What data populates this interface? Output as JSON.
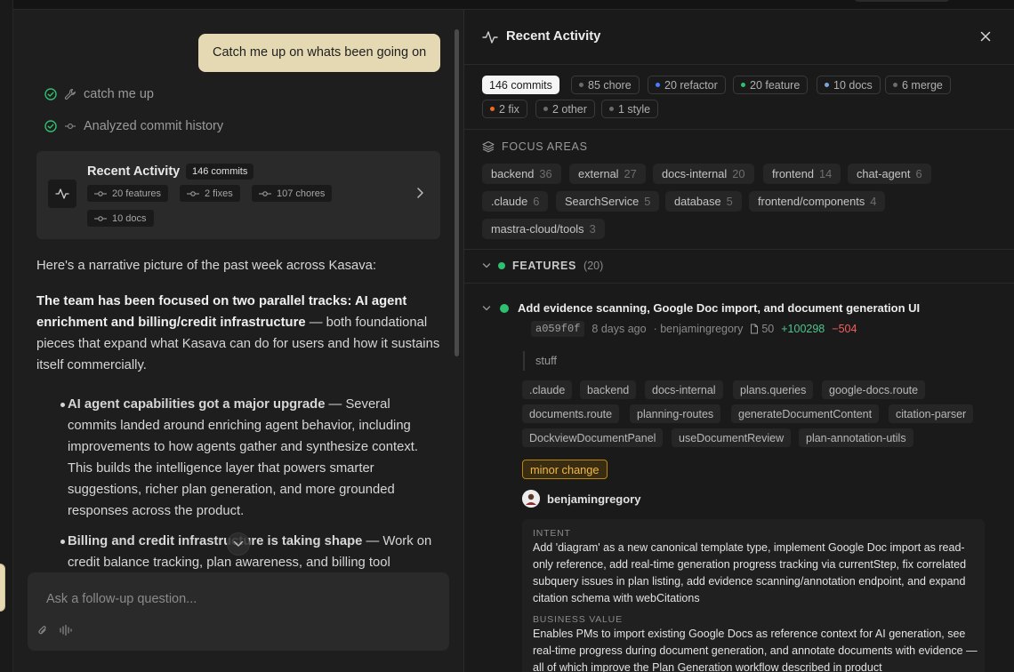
{
  "chat": {
    "user_message": "Catch me up on whats been going on",
    "steps": [
      {
        "label": "catch me up",
        "status": "done"
      },
      {
        "label": "Analyzed commit history",
        "status": "done"
      }
    ],
    "activity_card": {
      "title": "Recent Activity",
      "count": "146 commits",
      "stats": [
        "20 features",
        "2 fixes",
        "107 chores",
        "10 docs"
      ]
    },
    "intro": "Here's a narrative picture of the past week across Kasava:",
    "p2_bold": "The team has been focused on two parallel tracks: AI agent enrichment and billing/credit infrastructure",
    "p2_rest": " — both foundational pieces that expand what Kasava can do for users and how it sustains itself commercially.",
    "bullets": [
      {
        "bold": "AI agent capabilities got a major upgrade",
        "rest": " — Several commits landed around enriching agent behavior, including improvements to how agents gather and synthesize context. This builds the intelligence layer that powers smarter suggestions, richer plan generation, and more grounded responses across the product."
      },
      {
        "bold": "Billing and credit infrastructure is taking shape",
        "rest": " — Work on credit balance tracking, plan awareness, and billing tool"
      }
    ],
    "composer_placeholder": "Ask a follow-up question..."
  },
  "panel": {
    "title": "Recent Activity",
    "filters": [
      {
        "label": "146 commits",
        "active": true,
        "color": ""
      },
      {
        "label": "85 chore",
        "active": false,
        "color": "#6b6b6b"
      },
      {
        "label": "20 refactor",
        "active": false,
        "color": "#4a7cff"
      },
      {
        "label": "20 feature",
        "active": false,
        "color": "#2fbf71"
      },
      {
        "label": "10 docs",
        "active": false,
        "color": "#7aa7d9"
      },
      {
        "label": "6 merge",
        "active": false,
        "color": "#6b6b6b"
      },
      {
        "label": "2 fix",
        "active": false,
        "color": "#f26b1d"
      },
      {
        "label": "2 other",
        "active": false,
        "color": "#6b6b6b"
      },
      {
        "label": "1 style",
        "active": false,
        "color": "#6b6b6b"
      }
    ],
    "focus_label": "FOCUS AREAS",
    "focus_areas": [
      {
        "name": "backend",
        "count": "36"
      },
      {
        "name": "external",
        "count": "27"
      },
      {
        "name": "docs-internal",
        "count": "20"
      },
      {
        "name": "frontend",
        "count": "14"
      },
      {
        "name": "chat-agent",
        "count": "6"
      },
      {
        "name": ".claude",
        "count": "6"
      },
      {
        "name": "SearchService",
        "count": "5"
      },
      {
        "name": "database",
        "count": "5"
      },
      {
        "name": "frontend/components",
        "count": "4"
      },
      {
        "name": "mastra-cloud/tools",
        "count": "3"
      }
    ],
    "features_label": "FEATURES",
    "features_count": "(20)",
    "commit": {
      "title": "Add evidence scanning, Google Doc import, and document generation UI",
      "sha": "a059f0f",
      "age": "8 days ago",
      "author_meta": "· benjamingregory",
      "files": "50",
      "additions": "+100298",
      "deletions": "−504",
      "message": "stuff",
      "tags": [
        ".claude",
        "backend",
        "docs-internal",
        "plans.queries",
        "google-docs.route",
        "documents.route",
        "planning-routes",
        "generateDocumentContent",
        "citation-parser",
        "DockviewDocumentPanel",
        "useDocumentReview",
        "plan-annotation-utils"
      ],
      "badge": "minor change",
      "author": "benjamingregory",
      "intent_label": "INTENT",
      "intent": "Add 'diagram' as a new canonical template type, implement Google Doc import as read-only reference, add real-time generation progress tracking via currentStep, fix correlated subquery issues in plan listing, add evidence scanning/annotation endpoint, and expand citation schema with webCitations",
      "business_label": "BUSINESS VALUE",
      "business": "Enables PMs to import existing Google Docs as reference context for AI generation, see real-time progress during document generation, and annotate documents with evidence — all of which improve the Plan Generation workflow described in product"
    }
  }
}
